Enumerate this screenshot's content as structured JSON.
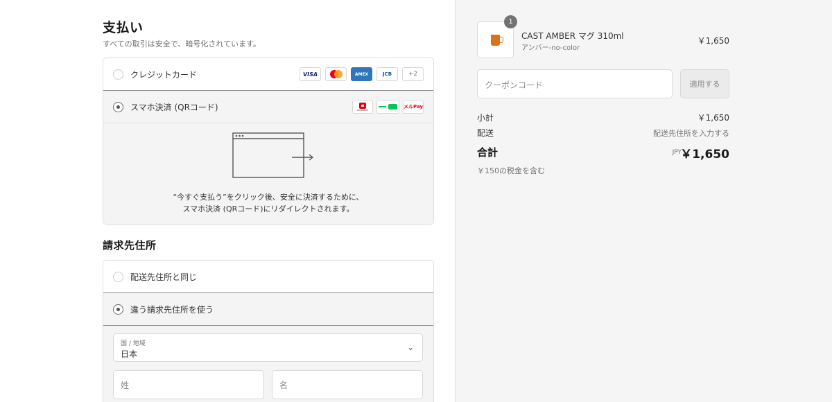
{
  "payment": {
    "title": "支払い",
    "subtitle": "すべての取引は安全で、暗号化されています。",
    "credit_card_label": "クレジットカード",
    "card_brands": [
      "VISA",
      "MC",
      "AMEX",
      "JCB",
      "+2"
    ],
    "qr_label": "スマホ決済 (QRコード)",
    "qr_brands": [
      "PayPay",
      "LINE Pay",
      "メルPay"
    ],
    "redirect_line1": "“今すぐ支払う”をクリック後、安全に決済するために、",
    "redirect_line2": "スマホ決済 (QRコード)にリダイレクトされます。"
  },
  "billing": {
    "title": "請求先住所",
    "same_label": "配送先住所と同じ",
    "different_label": "違う請求先住所を使う",
    "country_label": "国 / 地域",
    "country_value": "日本",
    "last_name_placeholder": "姓",
    "first_name_placeholder": "名"
  },
  "order": {
    "quantity": "1",
    "product_name": "CAST AMBER マグ 310ml",
    "product_variant": "アンバー-no-color",
    "product_price": "￥1,650",
    "coupon_placeholder": "クーポンコード",
    "coupon_button": "適用する",
    "subtotal_label": "小計",
    "subtotal_value": "￥1,650",
    "shipping_label": "配送",
    "shipping_value": "配送先住所を入力する",
    "total_label": "合計",
    "total_currency": "JPY",
    "total_value": "￥1,650",
    "tax_note": "￥150の税金を含む"
  },
  "colors": {
    "sidebar_bg": "#f5f5f5",
    "selected_row_bg": "#f4f4f4",
    "amex_blue": "#2e77bb",
    "paypay_red": "#e60012",
    "line_green": "#06c755",
    "mug_amber": "#d9721c"
  }
}
